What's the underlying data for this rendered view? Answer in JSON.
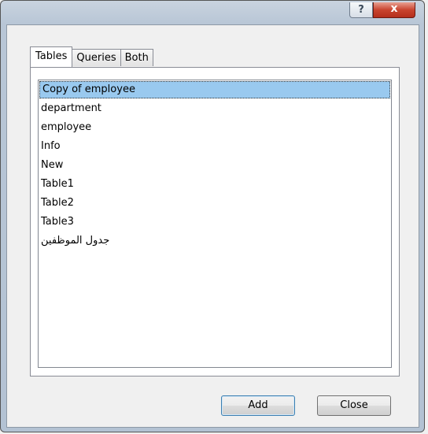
{
  "titlebar": {
    "help_glyph": "?",
    "close_glyph": "x"
  },
  "tabs": [
    {
      "label": "Tables",
      "active": true
    },
    {
      "label": "Queries",
      "active": false
    },
    {
      "label": "Both",
      "active": false
    }
  ],
  "list": {
    "items": [
      "Copy of employee",
      "department",
      "employee",
      "Info",
      "New",
      "Table1",
      "Table2",
      "Table3",
      "جدول الموظفين"
    ],
    "selected": "Copy of employee"
  },
  "buttons": {
    "add_label": "Add",
    "close_label": "Close"
  }
}
